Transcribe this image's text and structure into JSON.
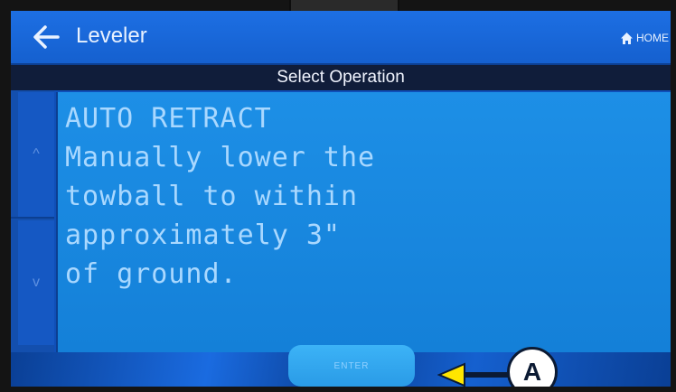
{
  "header": {
    "title": "Leveler",
    "home_label": "HOME"
  },
  "subheader": {
    "title": "Select Operation"
  },
  "side_buttons": {
    "up_glyph": "^",
    "down_glyph": "v"
  },
  "message": {
    "lines": [
      "AUTO RETRACT",
      "Manually lower the",
      "towball to within",
      "approximately 3\"",
      "of ground."
    ]
  },
  "footer": {
    "enter_label": "ENTER"
  },
  "callout": {
    "letter": "A",
    "arrow_color": "#ffe600"
  },
  "colors": {
    "title_bar": "#1d6fe3",
    "message_bg": "#1d8fe6",
    "message_text": "#a9d8ff",
    "enter_button": "#3cb3f7"
  },
  "icons": {
    "back": "arrow-left-icon",
    "home": "home-icon"
  }
}
